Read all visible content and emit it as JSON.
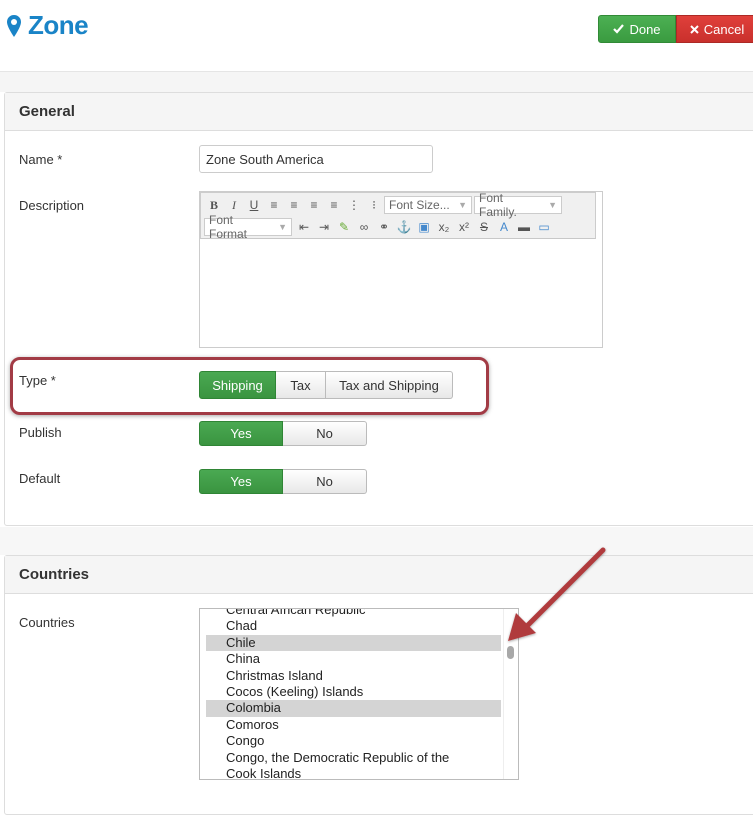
{
  "page": {
    "title": "Zone",
    "icon": "map-marker-icon"
  },
  "header": {
    "done_label": "Done",
    "cancel_label": "Cancel",
    "done_color": "#45a84c",
    "cancel_color": "#d9423d"
  },
  "general": {
    "heading": "General",
    "name_label": "Name *",
    "name_value": "Zone South America",
    "description_label": "Description",
    "editor": {
      "font_size_placeholder": "Font Size...",
      "font_family_placeholder": "Font Family.",
      "font_format_placeholder": "Font Format",
      "bold": "B",
      "italic": "I",
      "underline": "U"
    },
    "type_label": "Type *",
    "type_options": [
      "Shipping",
      "Tax",
      "Tax and Shipping"
    ],
    "type_selected": "Shipping",
    "publish_label": "Publish",
    "publish_options": [
      "Yes",
      "No"
    ],
    "publish_selected": "Yes",
    "default_label": "Default",
    "default_options": [
      "Yes",
      "No"
    ],
    "default_selected": "Yes"
  },
  "countries": {
    "heading": "Countries",
    "label": "Countries",
    "items": [
      "Central African Republic",
      "Chad",
      "Chile",
      "China",
      "Christmas Island",
      "Cocos (Keeling) Islands",
      "Colombia",
      "Comoros",
      "Congo",
      "Congo, the Democratic Republic of the",
      "Cook Islands"
    ],
    "selected": [
      "Chile",
      "Colombia"
    ]
  },
  "annotation_color": "#b03a3e"
}
